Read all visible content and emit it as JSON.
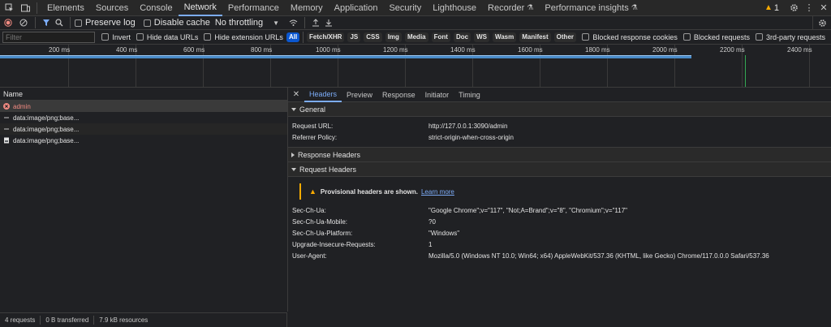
{
  "tabs": [
    "Elements",
    "Sources",
    "Console",
    "Network",
    "Performance",
    "Memory",
    "Application",
    "Security",
    "Lighthouse",
    "Recorder",
    "Performance insights"
  ],
  "active_tab": "Network",
  "warnings_count": "1",
  "toolbar": {
    "preserve_log": "Preserve log",
    "disable_cache": "Disable cache",
    "throttling": "No throttling"
  },
  "filterbar": {
    "filter_placeholder": "Filter",
    "invert": "Invert",
    "hide_data_urls": "Hide data URLs",
    "hide_extension_urls": "Hide extension URLs",
    "chips": [
      "All",
      "Fetch/XHR",
      "JS",
      "CSS",
      "Img",
      "Media",
      "Font",
      "Doc",
      "WS",
      "Wasm",
      "Manifest",
      "Other"
    ],
    "blocked_response_cookies": "Blocked response cookies",
    "blocked_requests": "Blocked requests",
    "third_party": "3rd-party requests"
  },
  "overview": {
    "ticks": [
      "200 ms",
      "400 ms",
      "600 ms",
      "800 ms",
      "1000 ms",
      "1200 ms",
      "1400 ms",
      "1600 ms",
      "1800 ms",
      "2000 ms",
      "2200 ms",
      "2400 ms"
    ]
  },
  "requests": {
    "header": "Name",
    "rows": [
      "admin",
      "data:image/png;base...",
      "data:image/png;base...",
      "data:image/png;base..."
    ]
  },
  "details": {
    "tabs": [
      "Headers",
      "Preview",
      "Response",
      "Initiator",
      "Timing"
    ],
    "general": {
      "title": "General",
      "request_url_key": "Request URL:",
      "request_url": "http://127.0.0.1:3090/admin",
      "referrer_policy_key": "Referrer Policy:",
      "referrer_policy": "strict-origin-when-cross-origin"
    },
    "response_headers_title": "Response Headers",
    "request_headers_title": "Request Headers",
    "warning_text": "Provisional headers are shown.",
    "learn_more": "Learn more",
    "headers": [
      {
        "k": "Sec-Ch-Ua:",
        "v": "\"Google Chrome\";v=\"117\", \"Not;A=Brand\";v=\"8\", \"Chromium\";v=\"117\""
      },
      {
        "k": "Sec-Ch-Ua-Mobile:",
        "v": "?0"
      },
      {
        "k": "Sec-Ch-Ua-Platform:",
        "v": "\"Windows\""
      },
      {
        "k": "Upgrade-Insecure-Requests:",
        "v": "1"
      },
      {
        "k": "User-Agent:",
        "v": "Mozilla/5.0 (Windows NT 10.0; Win64; x64) AppleWebKit/537.36 (KHTML, like Gecko) Chrome/117.0.0.0 Safari/537.36"
      }
    ]
  },
  "status": {
    "requests": "4 requests",
    "transferred": "0 B transferred",
    "resources": "7.9 kB resources"
  },
  "colors": {
    "accent": "#7cacf8",
    "error": "#f28b82",
    "warning": "#f9ab00",
    "waterfall": "#4a8bc8"
  }
}
